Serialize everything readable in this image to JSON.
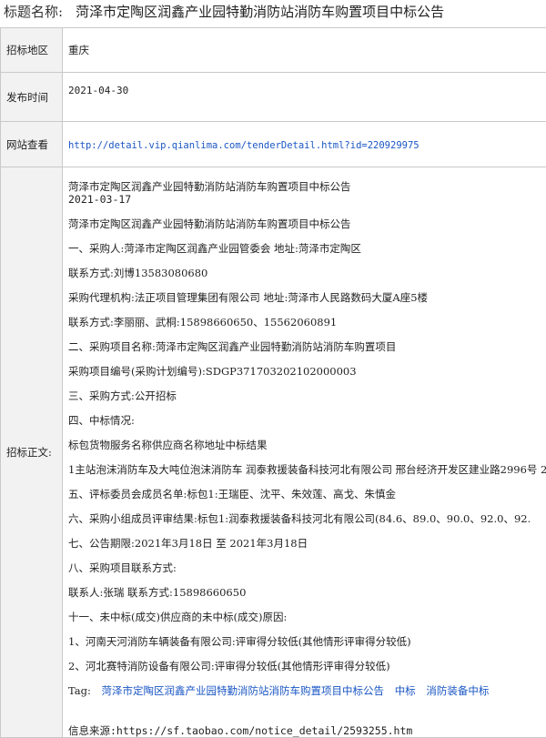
{
  "header": {
    "label": "标题名称:",
    "title": "菏泽市定陶区润鑫产业园特勤消防站消防车购置项目中标公告"
  },
  "fields": {
    "region_label": "招标地区",
    "region": "重庆",
    "pubtime_label": "发布时间",
    "pubtime": "2021-04-30",
    "url_label": "网站查看",
    "url": "http://detail.vip.qianlima.com/tenderDetail.html?id=220929975",
    "body_label": "招标正文:"
  },
  "body": {
    "lines": [
      "菏泽市定陶区润鑫产业园特勤消防站消防车购置项目中标公告",
      "2021-03-17",
      "菏泽市定陶区润鑫产业园特勤消防站消防车购置项目中标公告",
      "一、采购人:菏泽市定陶区润鑫产业园管委会 地址:菏泽市定陶区",
      "联系方式:刘博13583080680",
      "采购代理机构:法正项目管理集团有限公司 地址:菏泽市人民路数码大厦A座5楼",
      "联系方式:李丽丽、武桐:15898660650、15562060891",
      "二、采购项目名称:菏泽市定陶区润鑫产业园特勤消防站消防车购置项目",
      "采购项目编号(采购计划编号):SDGP371703202102000003",
      "三、采购方式:公开招标",
      "四、中标情况:",
      "标包货物服务名称供应商名称地址中标结果",
      "1主站泡沫消防车及大吨位泡沫消防车 润泰救援装备科技河北有限公司 邢台经济开发区建业路2996号 2",
      "五、评标委员会成员名单:标包1:王瑞臣、沈平、朱效莲、高戈、朱慎金",
      "六、采购小组成员评审结果:标包1:润泰救援装备科技河北有限公司(84.6、89.0、90.0、92.0、92.",
      "七、公告期限:2021年3月18日 至 2021年3月18日",
      "八、采购项目联系方式:",
      "联系人:张瑞 联系方式:15898660650",
      "十一、未中标(成交)供应商的未中标(成交)原因:",
      "1、河南天河消防车辆装备有限公司:评审得分较低(其他情形评审得分较低)",
      "2、河北赛特消防设备有限公司:评审得分较低(其他情形评审得分较低)"
    ],
    "tag_label": "Tag:",
    "tags": [
      "菏泽市定陶区润鑫产业园特勤消防站消防车购置项目中标公告",
      "中标",
      "消防装备中标"
    ],
    "source": "信息来源:https://sf.taobao.com/notice_detail/2593255.htm"
  }
}
